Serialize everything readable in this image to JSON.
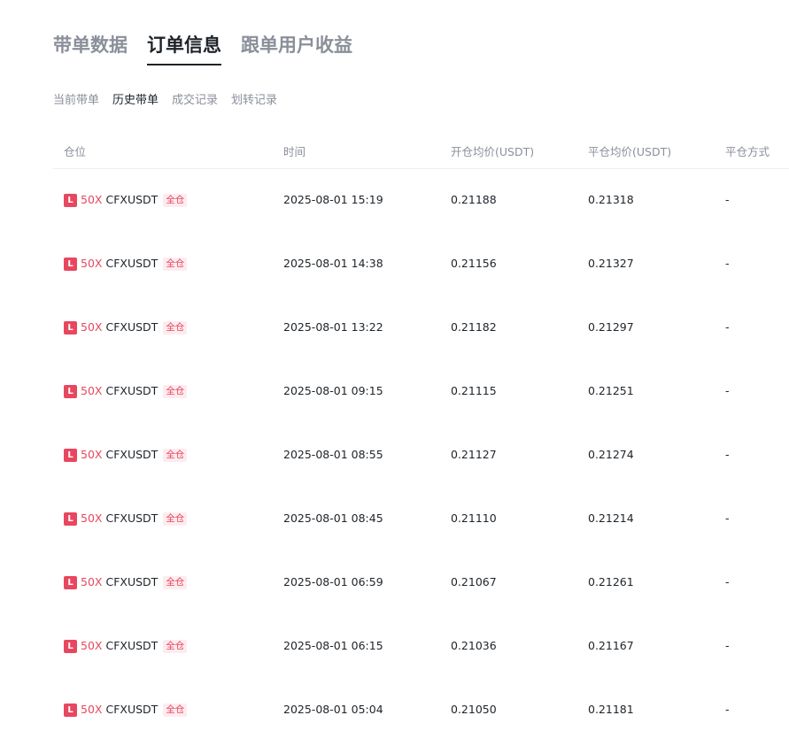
{
  "main_tabs": [
    {
      "label": "带单数据",
      "active": false
    },
    {
      "label": "订单信息",
      "active": true
    },
    {
      "label": "跟单用户收益",
      "active": false
    }
  ],
  "sub_tabs": [
    {
      "label": "当前带单",
      "active": false
    },
    {
      "label": "历史带单",
      "active": true
    },
    {
      "label": "成交记录",
      "active": false
    },
    {
      "label": "划转记录",
      "active": false
    }
  ],
  "table": {
    "headers": [
      "仓位",
      "时间",
      "开仓均价(USDT)",
      "平仓均价(USDT)",
      "平仓方式"
    ],
    "rows": [
      {
        "side": "L",
        "leverage": "50X",
        "symbol": "CFXUSDT",
        "margin": "全仓",
        "time": "2025-08-01 15:19",
        "open": "0.21188",
        "close": "0.21318",
        "method": "-"
      },
      {
        "side": "L",
        "leverage": "50X",
        "symbol": "CFXUSDT",
        "margin": "全仓",
        "time": "2025-08-01 14:38",
        "open": "0.21156",
        "close": "0.21327",
        "method": "-"
      },
      {
        "side": "L",
        "leverage": "50X",
        "symbol": "CFXUSDT",
        "margin": "全仓",
        "time": "2025-08-01 13:22",
        "open": "0.21182",
        "close": "0.21297",
        "method": "-"
      },
      {
        "side": "L",
        "leverage": "50X",
        "symbol": "CFXUSDT",
        "margin": "全仓",
        "time": "2025-08-01 09:15",
        "open": "0.21115",
        "close": "0.21251",
        "method": "-"
      },
      {
        "side": "L",
        "leverage": "50X",
        "symbol": "CFXUSDT",
        "margin": "全仓",
        "time": "2025-08-01 08:55",
        "open": "0.21127",
        "close": "0.21274",
        "method": "-"
      },
      {
        "side": "L",
        "leverage": "50X",
        "symbol": "CFXUSDT",
        "margin": "全仓",
        "time": "2025-08-01 08:45",
        "open": "0.21110",
        "close": "0.21214",
        "method": "-"
      },
      {
        "side": "L",
        "leverage": "50X",
        "symbol": "CFXUSDT",
        "margin": "全仓",
        "time": "2025-08-01 06:59",
        "open": "0.21067",
        "close": "0.21261",
        "method": "-"
      },
      {
        "side": "L",
        "leverage": "50X",
        "symbol": "CFXUSDT",
        "margin": "全仓",
        "time": "2025-08-01 06:15",
        "open": "0.21036",
        "close": "0.21167",
        "method": "-"
      },
      {
        "side": "L",
        "leverage": "50X",
        "symbol": "CFXUSDT",
        "margin": "全仓",
        "time": "2025-08-01 05:04",
        "open": "0.21050",
        "close": "0.21181",
        "method": "-"
      }
    ]
  },
  "colors": {
    "long": "#e8475f",
    "text_primary": "#1e2329",
    "text_secondary": "#8a8f99"
  }
}
